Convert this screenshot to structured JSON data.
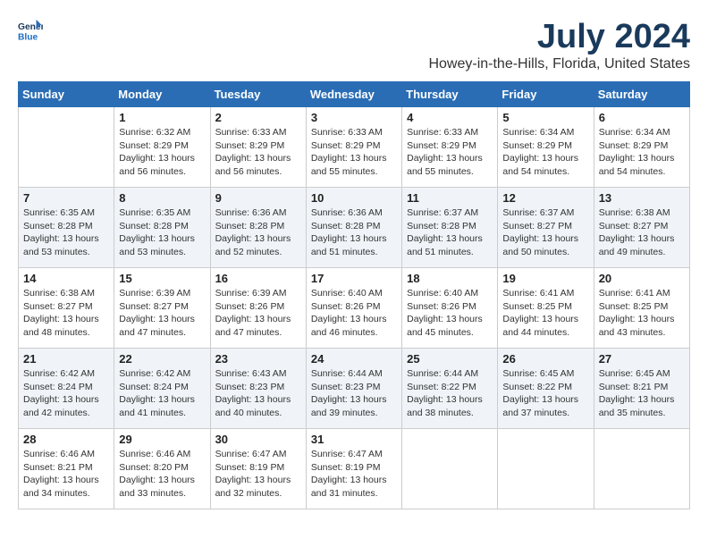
{
  "header": {
    "logo_line1": "General",
    "logo_line2": "Blue",
    "title": "July 2024",
    "subtitle": "Howey-in-the-Hills, Florida, United States"
  },
  "days_of_week": [
    "Sunday",
    "Monday",
    "Tuesday",
    "Wednesday",
    "Thursday",
    "Friday",
    "Saturday"
  ],
  "weeks": [
    [
      {
        "day": "",
        "info": ""
      },
      {
        "day": "1",
        "info": "Sunrise: 6:32 AM\nSunset: 8:29 PM\nDaylight: 13 hours\nand 56 minutes."
      },
      {
        "day": "2",
        "info": "Sunrise: 6:33 AM\nSunset: 8:29 PM\nDaylight: 13 hours\nand 56 minutes."
      },
      {
        "day": "3",
        "info": "Sunrise: 6:33 AM\nSunset: 8:29 PM\nDaylight: 13 hours\nand 55 minutes."
      },
      {
        "day": "4",
        "info": "Sunrise: 6:33 AM\nSunset: 8:29 PM\nDaylight: 13 hours\nand 55 minutes."
      },
      {
        "day": "5",
        "info": "Sunrise: 6:34 AM\nSunset: 8:29 PM\nDaylight: 13 hours\nand 54 minutes."
      },
      {
        "day": "6",
        "info": "Sunrise: 6:34 AM\nSunset: 8:29 PM\nDaylight: 13 hours\nand 54 minutes."
      }
    ],
    [
      {
        "day": "7",
        "info": "Sunrise: 6:35 AM\nSunset: 8:28 PM\nDaylight: 13 hours\nand 53 minutes."
      },
      {
        "day": "8",
        "info": "Sunrise: 6:35 AM\nSunset: 8:28 PM\nDaylight: 13 hours\nand 53 minutes."
      },
      {
        "day": "9",
        "info": "Sunrise: 6:36 AM\nSunset: 8:28 PM\nDaylight: 13 hours\nand 52 minutes."
      },
      {
        "day": "10",
        "info": "Sunrise: 6:36 AM\nSunset: 8:28 PM\nDaylight: 13 hours\nand 51 minutes."
      },
      {
        "day": "11",
        "info": "Sunrise: 6:37 AM\nSunset: 8:28 PM\nDaylight: 13 hours\nand 51 minutes."
      },
      {
        "day": "12",
        "info": "Sunrise: 6:37 AM\nSunset: 8:27 PM\nDaylight: 13 hours\nand 50 minutes."
      },
      {
        "day": "13",
        "info": "Sunrise: 6:38 AM\nSunset: 8:27 PM\nDaylight: 13 hours\nand 49 minutes."
      }
    ],
    [
      {
        "day": "14",
        "info": "Sunrise: 6:38 AM\nSunset: 8:27 PM\nDaylight: 13 hours\nand 48 minutes."
      },
      {
        "day": "15",
        "info": "Sunrise: 6:39 AM\nSunset: 8:27 PM\nDaylight: 13 hours\nand 47 minutes."
      },
      {
        "day": "16",
        "info": "Sunrise: 6:39 AM\nSunset: 8:26 PM\nDaylight: 13 hours\nand 47 minutes."
      },
      {
        "day": "17",
        "info": "Sunrise: 6:40 AM\nSunset: 8:26 PM\nDaylight: 13 hours\nand 46 minutes."
      },
      {
        "day": "18",
        "info": "Sunrise: 6:40 AM\nSunset: 8:26 PM\nDaylight: 13 hours\nand 45 minutes."
      },
      {
        "day": "19",
        "info": "Sunrise: 6:41 AM\nSunset: 8:25 PM\nDaylight: 13 hours\nand 44 minutes."
      },
      {
        "day": "20",
        "info": "Sunrise: 6:41 AM\nSunset: 8:25 PM\nDaylight: 13 hours\nand 43 minutes."
      }
    ],
    [
      {
        "day": "21",
        "info": "Sunrise: 6:42 AM\nSunset: 8:24 PM\nDaylight: 13 hours\nand 42 minutes."
      },
      {
        "day": "22",
        "info": "Sunrise: 6:42 AM\nSunset: 8:24 PM\nDaylight: 13 hours\nand 41 minutes."
      },
      {
        "day": "23",
        "info": "Sunrise: 6:43 AM\nSunset: 8:23 PM\nDaylight: 13 hours\nand 40 minutes."
      },
      {
        "day": "24",
        "info": "Sunrise: 6:44 AM\nSunset: 8:23 PM\nDaylight: 13 hours\nand 39 minutes."
      },
      {
        "day": "25",
        "info": "Sunrise: 6:44 AM\nSunset: 8:22 PM\nDaylight: 13 hours\nand 38 minutes."
      },
      {
        "day": "26",
        "info": "Sunrise: 6:45 AM\nSunset: 8:22 PM\nDaylight: 13 hours\nand 37 minutes."
      },
      {
        "day": "27",
        "info": "Sunrise: 6:45 AM\nSunset: 8:21 PM\nDaylight: 13 hours\nand 35 minutes."
      }
    ],
    [
      {
        "day": "28",
        "info": "Sunrise: 6:46 AM\nSunset: 8:21 PM\nDaylight: 13 hours\nand 34 minutes."
      },
      {
        "day": "29",
        "info": "Sunrise: 6:46 AM\nSunset: 8:20 PM\nDaylight: 13 hours\nand 33 minutes."
      },
      {
        "day": "30",
        "info": "Sunrise: 6:47 AM\nSunset: 8:19 PM\nDaylight: 13 hours\nand 32 minutes."
      },
      {
        "day": "31",
        "info": "Sunrise: 6:47 AM\nSunset: 8:19 PM\nDaylight: 13 hours\nand 31 minutes."
      },
      {
        "day": "",
        "info": ""
      },
      {
        "day": "",
        "info": ""
      },
      {
        "day": "",
        "info": ""
      }
    ]
  ]
}
